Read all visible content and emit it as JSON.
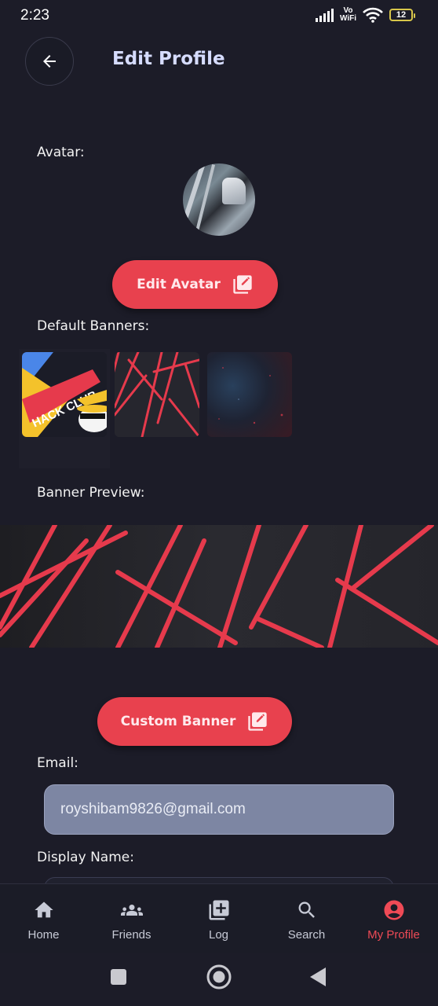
{
  "status_bar": {
    "time": "2:23",
    "network_label_top": "Vo",
    "network_label_bottom": "WiFi",
    "battery": "12"
  },
  "header": {
    "title": "Edit Profile"
  },
  "avatar_section": {
    "label": "Avatar:",
    "button_label": "Edit Avatar"
  },
  "banners": {
    "label": "Default Banners:",
    "thumb_text": "HACK CLUB"
  },
  "preview": {
    "label": "Banner Preview:"
  },
  "custom_banner": {
    "button_label": "Custom Banner"
  },
  "email": {
    "label": "Email:",
    "value": "royshibam9826@gmail.com"
  },
  "display_name": {
    "label": "Display Name:"
  },
  "nav": {
    "items": [
      {
        "label": "Home",
        "icon": "home-icon"
      },
      {
        "label": "Friends",
        "icon": "friends-icon"
      },
      {
        "label": "Log",
        "icon": "add-box-icon"
      },
      {
        "label": "Search",
        "icon": "search-icon"
      },
      {
        "label": "My Profile",
        "icon": "account-circle-icon"
      }
    ],
    "active_index": 4
  },
  "colors": {
    "accent": "#e8414e",
    "background": "#1c1c28",
    "title": "#d6dcff",
    "field": "#7d86a3"
  }
}
